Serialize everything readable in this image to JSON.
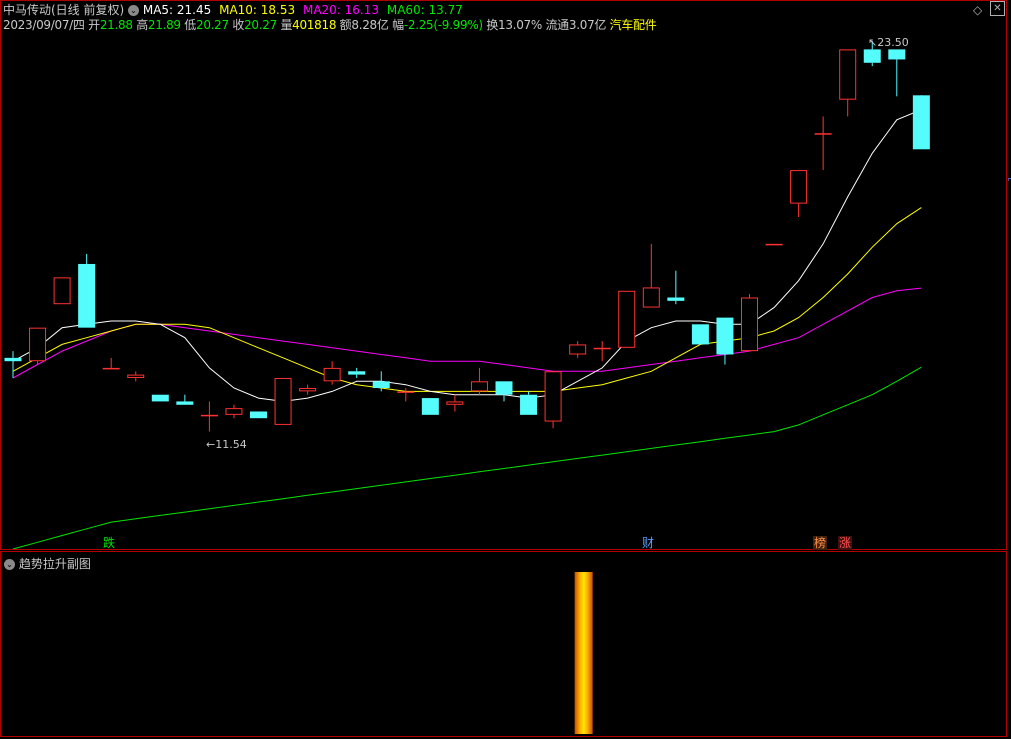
{
  "header": {
    "title": "中马传动(日线 前复权)",
    "ma5": "MA5: 21.45",
    "ma10": "MA10: 18.53",
    "ma20": "MA20: 16.13",
    "ma60": "MA60: 13.77",
    "date": "2023/09/07/四",
    "open_label": "开",
    "open_value": "21.88",
    "high_label": "高",
    "high_value": "21.89",
    "low_label": "低",
    "low_value": "20.27",
    "close_label": "收",
    "close_value": "20.27",
    "volume_label": "量",
    "volume_value": "401818",
    "amount_label": "额",
    "amount_value": "8.28亿",
    "change_label": "幅",
    "change_value": "-2.25(-9.99%)",
    "turnover": "换13.07%",
    "float_cap": "流通3.07亿",
    "sector": "汽车配件"
  },
  "annotations": {
    "high_price": "23.50",
    "low_price": "11.54"
  },
  "event_tags": [
    "跌",
    "财",
    "榜",
    "涨"
  ],
  "sub_panel": {
    "title": "趋势拉升副图"
  },
  "colors": {
    "up": "#ff3232",
    "down": "#54fcfc",
    "ma5": "#ffffff",
    "ma10": "#ffff00",
    "ma20": "#ff00ff",
    "ma60": "#00e600",
    "border": "#b00000"
  },
  "chart_data": {
    "type": "candlestick",
    "title": "中马传动(日线 前复权)",
    "candles": [
      {
        "o": 14.05,
        "h": 14.25,
        "l": 13.45,
        "c": 13.95
      },
      {
        "o": 13.95,
        "h": 14.95,
        "l": 13.85,
        "c": 14.95
      },
      {
        "o": 15.65,
        "h": 16.45,
        "l": 15.65,
        "c": 16.45
      },
      {
        "o": 16.85,
        "h": 17.15,
        "l": 14.95,
        "c": 14.95
      },
      {
        "o": 13.75,
        "h": 14.05,
        "l": 13.75,
        "c": 13.75
      },
      {
        "o": 13.45,
        "h": 13.65,
        "l": 13.35,
        "c": 13.55
      },
      {
        "o": 12.95,
        "h": 12.95,
        "l": 12.75,
        "c": 12.75
      },
      {
        "o": 12.75,
        "h": 12.95,
        "l": 12.65,
        "c": 12.65
      },
      {
        "o": 12.35,
        "h": 12.75,
        "l": 11.85,
        "c": 12.35
      },
      {
        "o": 12.35,
        "h": 12.65,
        "l": 12.25,
        "c": 12.55
      },
      {
        "o": 12.45,
        "h": 12.45,
        "l": 12.25,
        "c": 12.25
      },
      {
        "o": 12.05,
        "h": 13.45,
        "l": 12.05,
        "c": 13.45
      },
      {
        "o": 13.05,
        "h": 13.25,
        "l": 12.95,
        "c": 13.15
      },
      {
        "o": 13.35,
        "h": 13.95,
        "l": 13.25,
        "c": 13.75
      },
      {
        "o": 13.65,
        "h": 13.75,
        "l": 13.45,
        "c": 13.55
      },
      {
        "o": 13.35,
        "h": 13.65,
        "l": 13.05,
        "c": 13.15
      },
      {
        "o": 13.05,
        "h": 13.15,
        "l": 12.75,
        "c": 13.05
      },
      {
        "o": 12.85,
        "h": 12.85,
        "l": 12.35,
        "c": 12.35
      },
      {
        "o": 12.65,
        "h": 12.95,
        "l": 12.45,
        "c": 12.75
      },
      {
        "o": 13.05,
        "h": 13.75,
        "l": 12.95,
        "c": 13.35
      },
      {
        "o": 13.35,
        "h": 13.35,
        "l": 12.75,
        "c": 12.95
      },
      {
        "o": 12.95,
        "h": 13.05,
        "l": 12.35,
        "c": 12.35
      },
      {
        "o": 12.15,
        "h": 13.65,
        "l": 11.95,
        "c": 13.65
      },
      {
        "o": 14.15,
        "h": 14.55,
        "l": 14.05,
        "c": 14.45
      },
      {
        "o": 14.35,
        "h": 14.55,
        "l": 13.95,
        "c": 14.35
      },
      {
        "o": 14.35,
        "h": 16.05,
        "l": 14.35,
        "c": 16.05
      },
      {
        "o": 15.55,
        "h": 17.45,
        "l": 15.55,
        "c": 16.15
      },
      {
        "o": 15.85,
        "h": 16.65,
        "l": 15.65,
        "c": 15.75
      },
      {
        "o": 15.05,
        "h": 15.05,
        "l": 14.45,
        "c": 14.45
      },
      {
        "o": 15.25,
        "h": 15.25,
        "l": 13.85,
        "c": 14.15
      },
      {
        "o": 14.25,
        "h": 15.95,
        "l": 14.25,
        "c": 15.85
      },
      {
        "o": 17.45,
        "h": 17.45,
        "l": 17.45,
        "c": 17.45
      },
      {
        "o": 18.65,
        "h": 19.65,
        "l": 18.25,
        "c": 19.65
      },
      {
        "o": 20.75,
        "h": 21.25,
        "l": 19.65,
        "c": 20.75
      },
      {
        "o": 21.75,
        "h": 23.25,
        "l": 21.25,
        "c": 23.25
      },
      {
        "o": 23.25,
        "h": 23.5,
        "l": 22.75,
        "c": 22.85
      },
      {
        "o": 23.25,
        "h": 23.25,
        "l": 21.85,
        "c": 22.95
      },
      {
        "o": 21.88,
        "h": 21.89,
        "l": 20.27,
        "c": 20.27
      }
    ],
    "ma5": [
      13.95,
      14.35,
      14.95,
      15.05,
      15.15,
      15.15,
      15.05,
      14.65,
      13.75,
      13.15,
      12.85,
      12.75,
      12.85,
      13.05,
      13.35,
      13.35,
      13.25,
      13.05,
      12.95,
      12.95,
      12.95,
      12.85,
      12.95,
      13.35,
      13.75,
      14.55,
      14.95,
      15.15,
      15.15,
      15.05,
      15.05,
      15.55,
      16.35,
      17.45,
      18.85,
      20.15,
      21.15,
      21.45
    ],
    "ma10": [
      13.65,
      14.05,
      14.45,
      14.65,
      14.85,
      15.05,
      15.05,
      15.05,
      14.95,
      14.65,
      14.35,
      14.05,
      13.75,
      13.45,
      13.25,
      13.15,
      13.05,
      13.05,
      13.05,
      13.05,
      13.05,
      13.05,
      13.05,
      13.15,
      13.25,
      13.45,
      13.65,
      14.05,
      14.45,
      14.55,
      14.65,
      14.85,
      15.25,
      15.85,
      16.55,
      17.35,
      18.05,
      18.53
    ],
    "ma20": [
      13.45,
      13.85,
      14.25,
      14.55,
      14.85,
      15.05,
      15.05,
      14.95,
      14.85,
      14.75,
      14.65,
      14.55,
      14.45,
      14.35,
      14.25,
      14.15,
      14.05,
      13.95,
      13.95,
      13.95,
      13.85,
      13.75,
      13.65,
      13.65,
      13.65,
      13.75,
      13.85,
      13.95,
      14.05,
      14.15,
      14.25,
      14.45,
      14.65,
      15.05,
      15.45,
      15.85,
      16.05,
      16.13
    ],
    "ma60": [
      8.35,
      8.55,
      8.75,
      8.95,
      9.15,
      9.25,
      9.35,
      9.45,
      9.55,
      9.65,
      9.75,
      9.85,
      9.95,
      10.05,
      10.15,
      10.25,
      10.35,
      10.45,
      10.55,
      10.65,
      10.75,
      10.85,
      10.95,
      11.05,
      11.15,
      11.25,
      11.35,
      11.45,
      11.55,
      11.65,
      11.75,
      11.85,
      12.05,
      12.35,
      12.65,
      12.95,
      13.35,
      13.77
    ],
    "sub_bar": {
      "index": 23,
      "level": 1.0
    }
  }
}
